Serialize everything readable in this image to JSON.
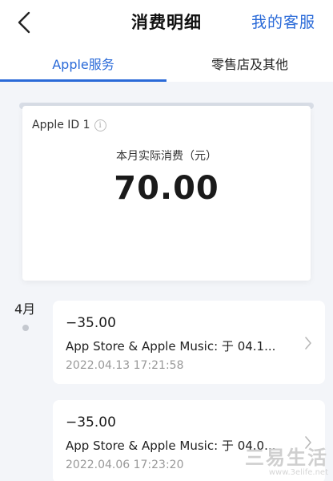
{
  "navbar": {
    "title": "消费明细",
    "action_label": "我的客服",
    "accent_color": "#2a6ad8"
  },
  "tabs": [
    {
      "label": "Apple服务",
      "active": true
    },
    {
      "label": "零售店及其他",
      "active": false
    }
  ],
  "summary": {
    "account_label": "Apple ID 1",
    "info_icon": "info-icon",
    "period_label": "本月实际消费（元）",
    "amount": "70.00"
  },
  "timeline": {
    "month_label": "4月",
    "transactions": [
      {
        "amount": "−35.00",
        "description": "App Store & Apple Music: 于 04.1...",
        "datetime": "2022.04.13 17:21:58"
      },
      {
        "amount": "−35.00",
        "description": "App Store & Apple Music: 于 04.0...",
        "datetime": "2022.04.06 17:23:20"
      }
    ]
  },
  "watermark": {
    "main": "三易生活",
    "sub": "www.3elife.net"
  }
}
